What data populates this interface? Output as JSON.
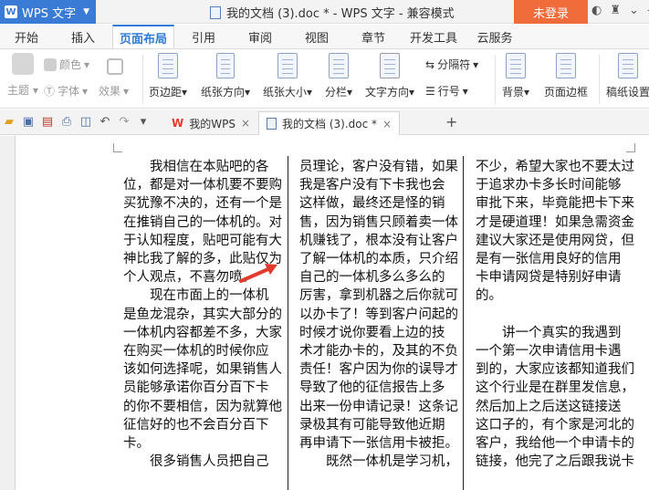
{
  "titlebar": {
    "app_name": "WPS 文字",
    "app_logo": "W",
    "doc_title": "我的文档 (3).doc * - WPS 文字 - 兼容模式",
    "login_label": "未登录"
  },
  "ribbon_tabs": [
    "开始",
    "插入",
    "页面布局",
    "引用",
    "审阅",
    "视图",
    "章节",
    "开发工具",
    "云服务"
  ],
  "active_tab": "页面布局",
  "ribbon": {
    "theme_label": "主题",
    "color_label": "颜色",
    "font_label": "字体",
    "effect_label": "效果",
    "margins_label": "页边距",
    "orientation_label": "纸张方向",
    "size_label": "纸张大小",
    "columns_label": "分栏",
    "text_direction_label": "文字方向",
    "breaks_label": "分隔符",
    "line_numbers_label": "行号",
    "background_label": "背景",
    "page_border_label": "页面边框",
    "manuscript_label": "稿纸设置"
  },
  "doc_tabs": [
    {
      "label": "我的WPS",
      "close": "×"
    },
    {
      "label": "我的文档 (3).doc *",
      "close": "×"
    }
  ],
  "add_tab": "+",
  "document": {
    "col1": [
      "　　我相信在本贴吧的各",
      "位，都是对一体机要不要购",
      "买犹豫不决的，还有一个是",
      "在推销自己的一体机的。对",
      "于认知程度，贴吧可能有大",
      "神比我了解的多，此贴仅为",
      "个人观点，不喜勿喷。",
      "　　现在市面上的一体机",
      "是鱼龙混杂，其实大部分的",
      "一体机内容都差不多，大家",
      "在购买一体机的时候你应",
      "该如何选择呢，如果销售人",
      "员能够承诺你百分百下卡",
      "的你不要相信，因为就算他",
      "征信好的也不会百分百下",
      "卡。",
      "　　很多销售人员把自己"
    ],
    "col2": [
      "员理论，客户没有错，如果",
      "我是客户没有下卡我也会",
      "这样做，最终还是怪的销",
      "售，因为销售只顾着卖一体",
      "机赚钱了，根本没有让客户",
      "了解一体机的本质，只介绍",
      "自己的一体机多么多么的",
      "厉害，拿到机器之后你就可",
      "以办卡了！等到客户问起的",
      "时候才说你要看上边的技",
      "术才能办卡的，及其的不负",
      "责任！客户因为你的误导才",
      "导致了他的征信报告上多",
      "出来一份申请记录！这条记",
      "录极其有可能导致他近期",
      "再申请下一张信用卡被拒。",
      "　　既然一体机是学习机，"
    ],
    "col3": [
      "不少，希望大家也不要太过",
      "于追求办卡多长时间能够",
      "审批下来，毕竟能把卡下来",
      "才是硬道理！如果急需资金",
      "建议大家还是使用网贷，但",
      "是有一张信用良好的信用",
      "卡申请网贷是特别好申请",
      "的。",
      "",
      "　　讲一个真实的我遇到",
      "一个第一次申请信用卡遇",
      "到的，大家应该都知道我们",
      "这个行业是在群里发信息，",
      "然后加上之后送这链接送",
      "这口子的，有个家是河北的",
      "客户，我给他一个申请卡的",
      "链接，他完了之后跟我说卡"
    ]
  },
  "colors": {
    "app_menu": "#3a7bd5",
    "login": "#f06c3a",
    "active_tab_text": "#2f7ad6",
    "arrow": "#e23b2e"
  }
}
